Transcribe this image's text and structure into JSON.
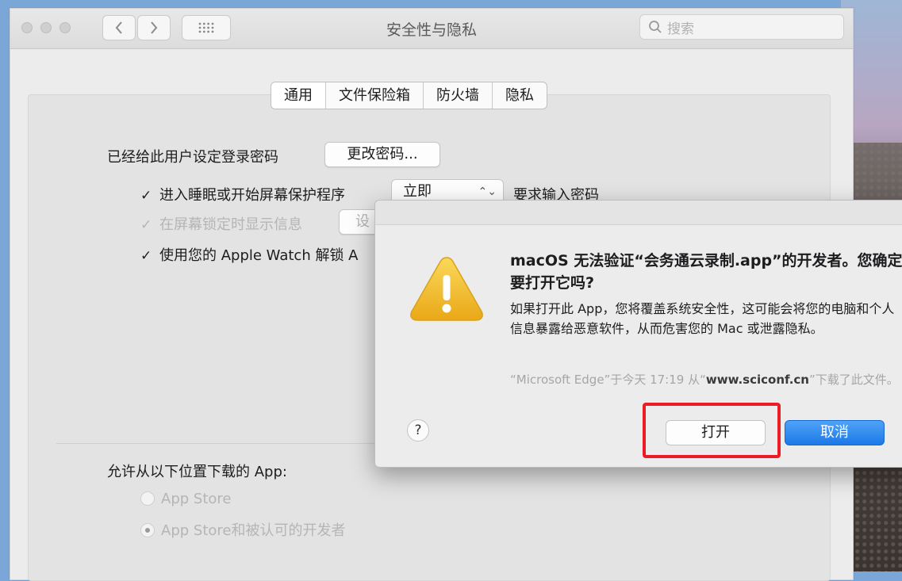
{
  "window": {
    "title": "安全性与隐私",
    "search_placeholder": "搜索",
    "tabs": [
      "通用",
      "文件保险箱",
      "防火墙",
      "隐私"
    ]
  },
  "general": {
    "password_label": "已经给此用户设定登录密码",
    "change_password_button": "更改密码...",
    "require_password": {
      "checked": true,
      "label": "进入睡眠或开始屏幕保护程序",
      "select_value": "立即",
      "suffix": "要求输入密码"
    },
    "show_message": {
      "checked": true,
      "disabled": true,
      "label": "在屏幕锁定时显示信息",
      "button_label": "设"
    },
    "apple_watch": {
      "checked": true,
      "label": "使用您的 Apple Watch 解锁 A"
    },
    "downloads_label": "允许从以下位置下载的 App:",
    "download_options": [
      {
        "label": "App Store",
        "selected": false
      },
      {
        "label": "App Store和被认可的开发者",
        "selected": true
      }
    ]
  },
  "alert": {
    "title": "macOS 无法验证“会务通云录制.app”的开发者。您确定要打开它吗?",
    "message": "如果打开此 App，您将覆盖系统安全性，这可能会将您的电脑和个人信息暴露给恶意软件，从而危害您的 Mac 或泄露隐私。",
    "note_prefix": "“Microsoft Edge”于今天 17:19 从“",
    "note_domain": "www.sciconf.cn",
    "note_suffix": "”下载了此文件。",
    "help_label": "?",
    "open_button": "打开",
    "cancel_button": "取消"
  },
  "colors": {
    "accent": "#1b78e8",
    "highlight": "#ec1c24",
    "warning": "#f5c024"
  },
  "icons": {
    "back": "chevron-left-icon",
    "forward": "chevron-right-icon",
    "grid": "grid-icon",
    "search": "search-icon",
    "warning": "warning-icon",
    "help": "help-icon"
  }
}
